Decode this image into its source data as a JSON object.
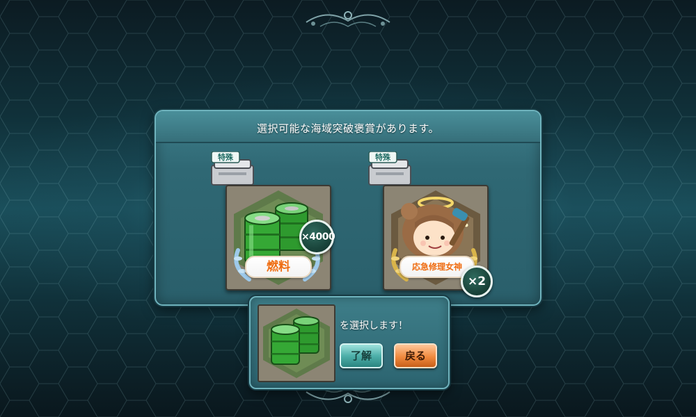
{
  "panel": {
    "title": "選択可能な海域突破褒賞があります。"
  },
  "rewards": [
    {
      "tag": "特殊",
      "item": "燃料",
      "count": "×4000",
      "icon": "fuel-drums-icon"
    },
    {
      "tag": "特殊",
      "item": "応急修理女神",
      "count": "×2",
      "icon": "repair-goddess-icon"
    }
  ],
  "confirm": {
    "message": "を選択します！",
    "ok_label": "了解",
    "back_label": "戻る",
    "selected_icon": "fuel-drums-icon"
  },
  "colors": {
    "panel": "#2f6874",
    "accent_orange": "#ef6d12",
    "ok_button": "#4eb0aa",
    "back_button": "#f08a3e"
  }
}
